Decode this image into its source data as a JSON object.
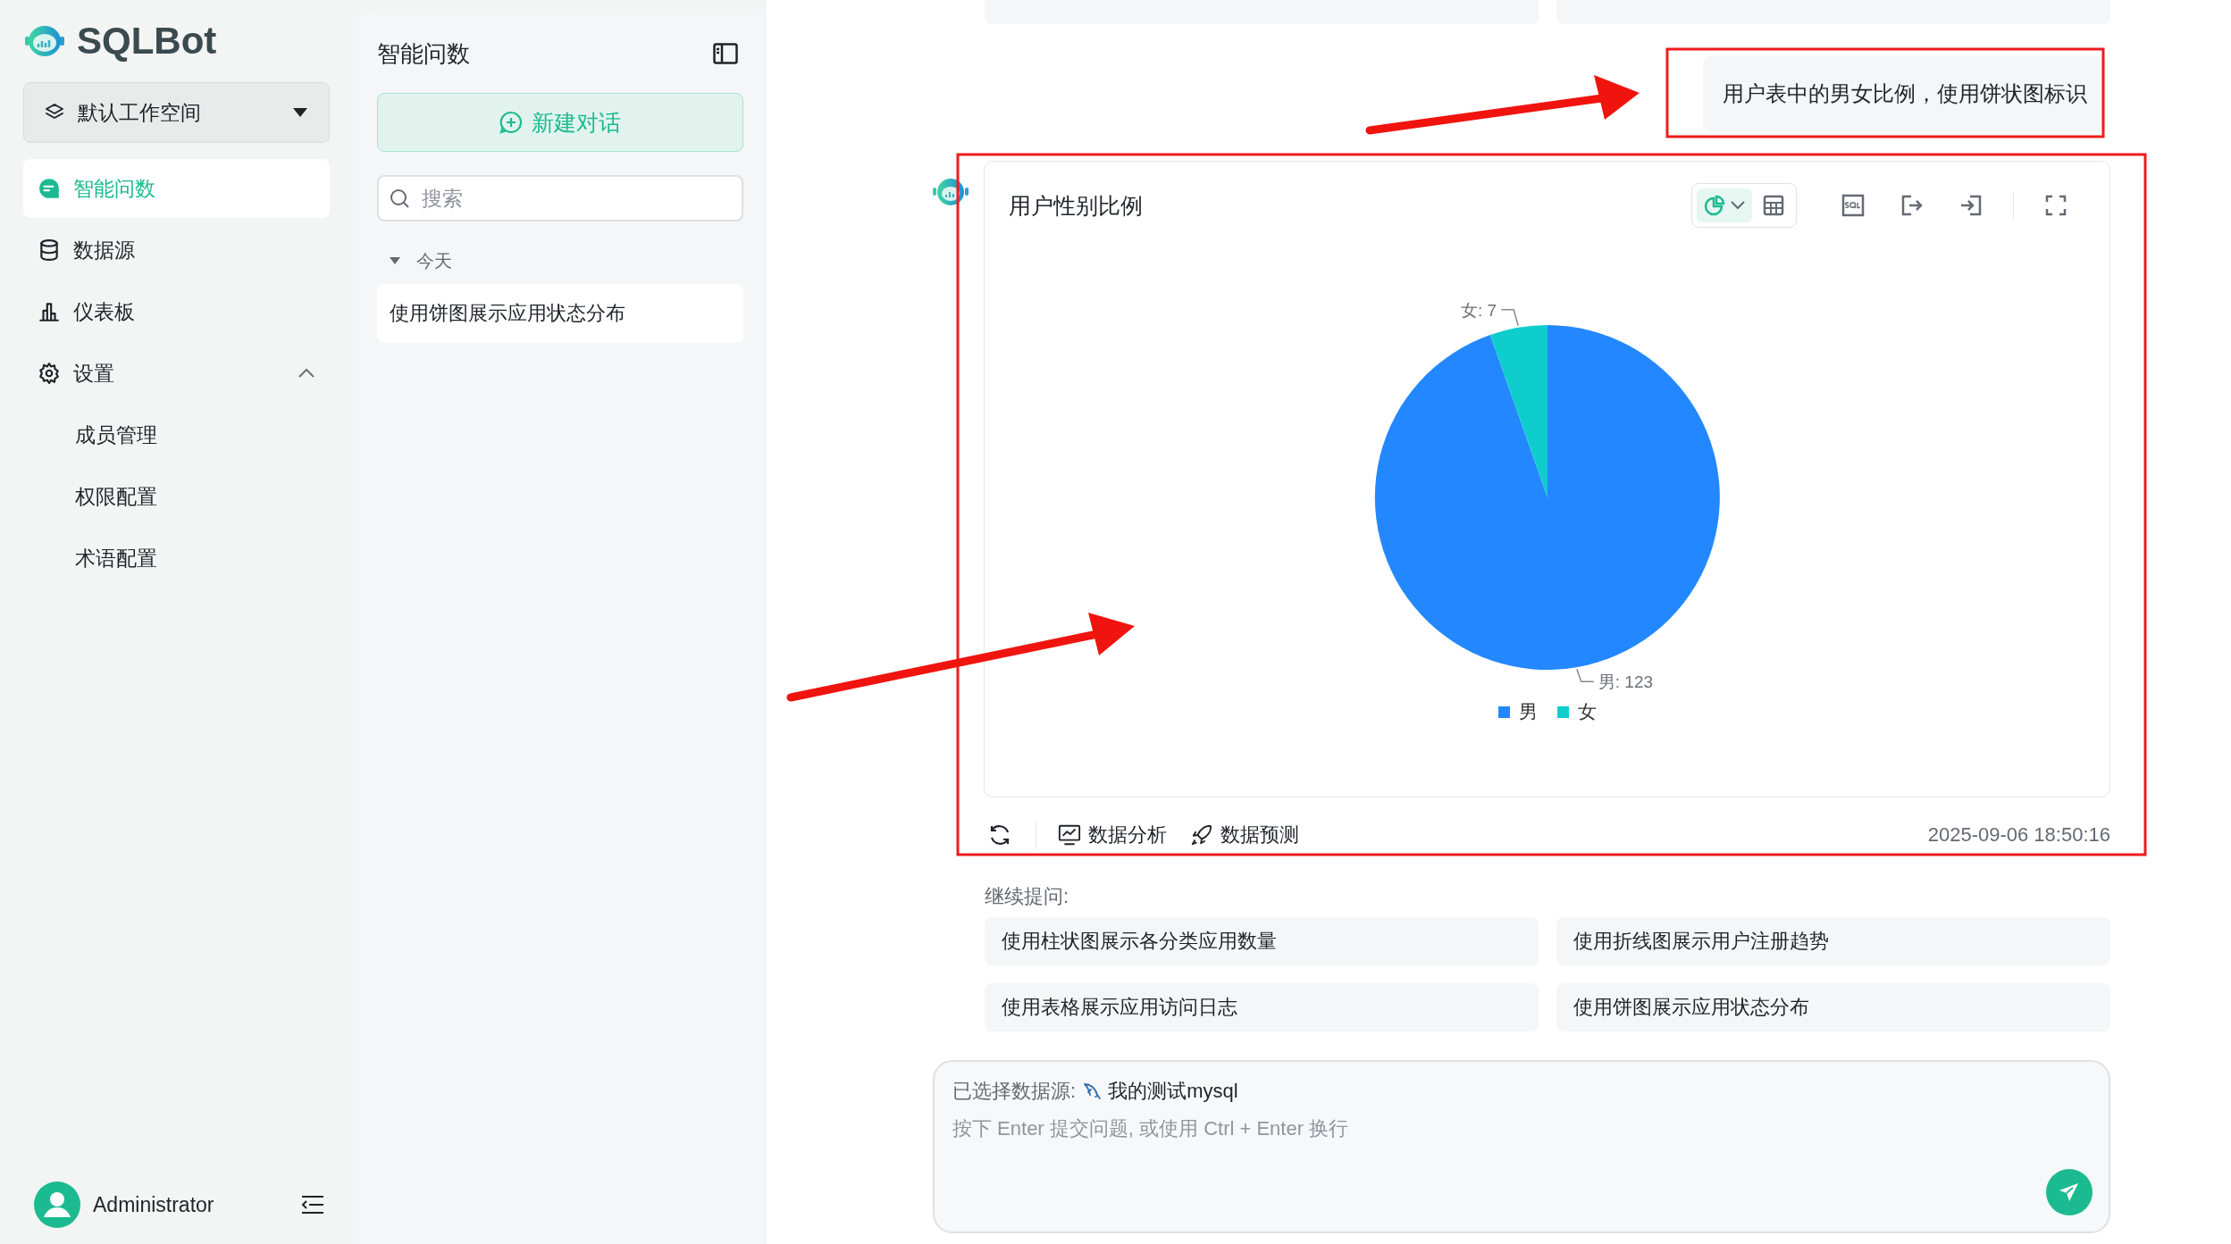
{
  "sidebar": {
    "logo": "SQLBot",
    "workspace": "默认工作空间",
    "nav": [
      {
        "label": "智能问数",
        "selected": true
      },
      {
        "label": "数据源",
        "selected": false
      },
      {
        "label": "仪表板",
        "selected": false
      },
      {
        "label": "设置",
        "selected": false,
        "expanded": true,
        "children": [
          {
            "label": "成员管理",
            "selected": false
          },
          {
            "label": "权限配置",
            "selected": false
          },
          {
            "label": "术语配置",
            "selected": false
          }
        ]
      }
    ],
    "user": {
      "name": "Administrator"
    }
  },
  "chat_panel": {
    "title": "智能问数",
    "new_chat": "新建对话",
    "search": {
      "placeholder": "搜索"
    },
    "groups": [
      {
        "label": "今天",
        "expanded": true,
        "items": [
          {
            "title": "使用饼图展示应用状态分布",
            "selected": true
          }
        ]
      }
    ]
  },
  "conversation": {
    "question": "用户表中的男女比例，使用饼状图标识",
    "answer": {
      "title": "用户性别比例",
      "views": [
        {
          "kind": "chart",
          "selected": true
        },
        {
          "kind": "table",
          "selected": false
        }
      ],
      "chart_data": {
        "type": "pie",
        "categories": [
          "男",
          "女"
        ],
        "values": [
          123,
          7
        ],
        "value_labels": [
          "男: 123",
          "女: 7"
        ]
      },
      "actions": [
        "数据分析",
        "数据预测"
      ],
      "time": "2025-09-06 18:50:16"
    },
    "follow_up": {
      "label": "继续提问:",
      "suggestions": [
        "使用柱状图展示各分类应用数量",
        "使用折线图展示用户注册趋势",
        "使用表格展示应用访问日志",
        "使用饼图展示应用状态分布"
      ]
    }
  },
  "input": {
    "datasource_label": "已选择数据源:",
    "datasource": "我的测试mysql",
    "placeholder": "按下 Enter 提交问题, 或使用 Ctrl + Enter 换行"
  }
}
